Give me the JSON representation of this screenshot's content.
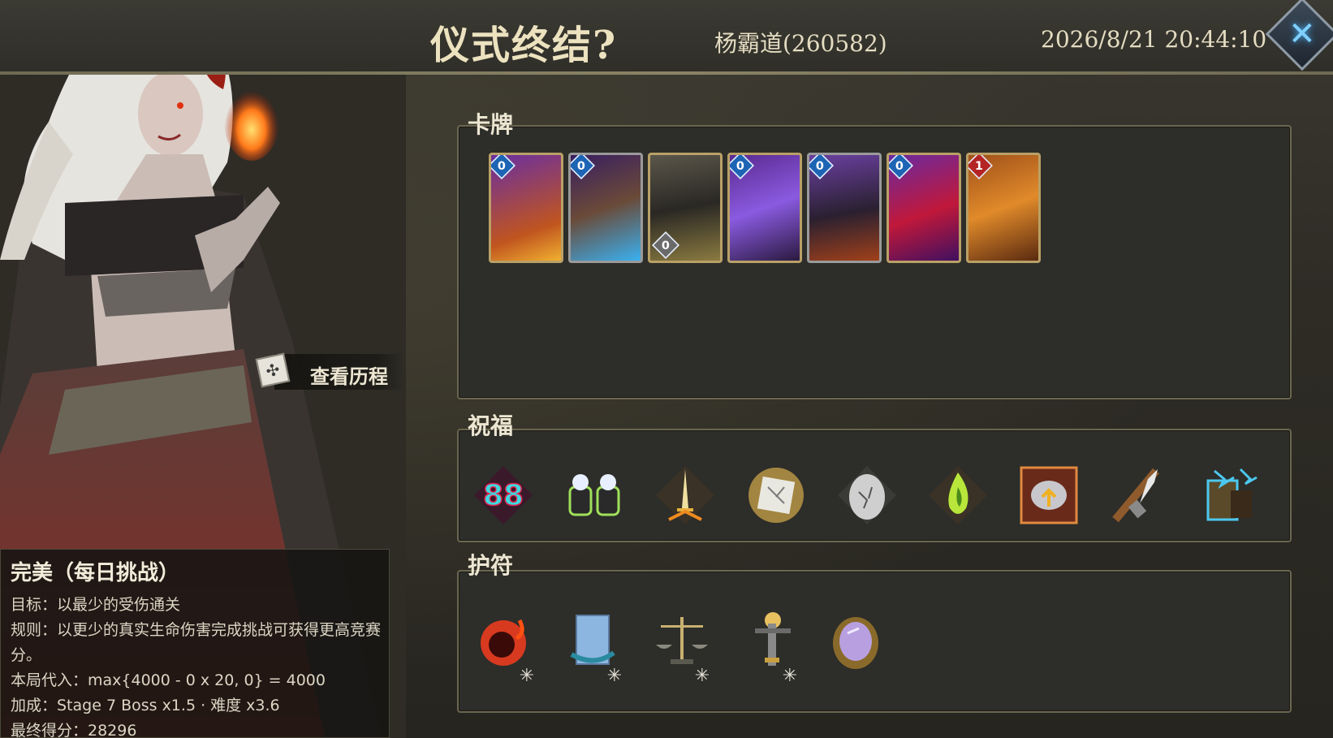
{
  "header": {
    "title": "仪式终结?",
    "player": "杨霸道(260582)",
    "datetime": "2026/8/21 20:44:10",
    "close_icon": "close-x-icon"
  },
  "sections": {
    "cards_label": "卡牌",
    "blessings_label": "祝福",
    "charms_label": "护符"
  },
  "cards": [
    {
      "cost": "0",
      "cost_color": "blue",
      "art": "purple-flame-gauntlet",
      "frame": "gold"
    },
    {
      "cost": "0",
      "cost_color": "blue",
      "art": "werewolf-lightning",
      "frame": "silver"
    },
    {
      "cost": "0",
      "cost_color": "blue",
      "art": "hooded-figure",
      "frame": "gold"
    },
    {
      "cost": "0",
      "cost_color": "blue",
      "art": "lightning-crystal",
      "frame": "gold"
    },
    {
      "cost": "0",
      "cost_color": "blue",
      "art": "volcano-smoke",
      "frame": "silver"
    },
    {
      "cost": "0",
      "cost_color": "blue",
      "art": "red-crystal-vines",
      "frame": "gold"
    },
    {
      "cost": "1",
      "cost_color": "red",
      "art": "fire-tornado",
      "frame": "gold"
    }
  ],
  "blessings": [
    {
      "name": "double-eight-icon",
      "color": "#3fd8e0"
    },
    {
      "name": "glowing-gauntlets-icon",
      "color": "#9fe05a"
    },
    {
      "name": "sword-burst-icon",
      "color": "#e8b03c"
    },
    {
      "name": "shattered-shield-icon",
      "color": "#f0c050"
    },
    {
      "name": "cracked-egg-icon",
      "color": "#cfcfcf"
    },
    {
      "name": "green-flame-icon",
      "color": "#b8e63a"
    },
    {
      "name": "brain-upgrade-icon",
      "color": "#e08a40"
    },
    {
      "name": "dagger-strike-icon",
      "color": "#f08a30"
    },
    {
      "name": "lightning-card-icon",
      "color": "#4cc8f0"
    }
  ],
  "charms": [
    {
      "name": "fire-egg-icon",
      "color": "#d83a20"
    },
    {
      "name": "scroll-map-icon",
      "color": "#8cb6e0"
    },
    {
      "name": "balance-scale-icon",
      "color": "#c8b070"
    },
    {
      "name": "glowing-key-icon",
      "color": "#e8c060"
    },
    {
      "name": "purple-mirror-icon",
      "color": "#b8a0e0"
    }
  ],
  "history": {
    "label": "查看历程",
    "icon": "scroll-history-icon"
  },
  "info": {
    "title": "完美（每日挑战）",
    "goal": "目标：以最少的受伤通关",
    "rule": "规则：以更少的真实生命伤害完成挑战可获得更高竞赛分。",
    "formula": "本局代入：max{4000 - 0 x 20, 0} = 4000",
    "bonus": "加成：Stage 7 Boss x1.5 · 难度 x3.6",
    "score": "最终得分：28296"
  }
}
